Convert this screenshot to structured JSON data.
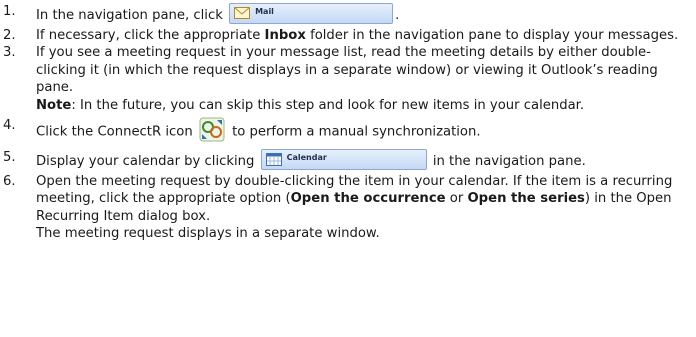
{
  "steps": [
    {
      "number": "1.",
      "before": "In the navigation pane, click",
      "button_label": "Mail",
      "after": "."
    },
    {
      "number": "2.",
      "before": "If necessary, click the appropriate",
      "bold": "Inbox",
      "after": "folder in the navigation pane to display your messages."
    },
    {
      "number": "3.",
      "text": "If you see a meeting request in your message list, read the meeting details by either double-clicking it (in which the request displays in a separate window) or viewing it Outlook’s reading pane.",
      "note_label": "Note",
      "note_text": ": In the future, you can skip this step and look for new items in your calendar."
    },
    {
      "number": "4.",
      "before": "Click the ConnectR icon",
      "after": "to perform a manual synchronization."
    },
    {
      "number": "5.",
      "before": "Display your calendar by clicking",
      "button_label": "Calendar",
      "after": "in the navigation pane."
    },
    {
      "number": "6.",
      "text": "Open the meeting request by double-clicking the item in your calendar. If the item is a recurring meeting, click the appropriate option (",
      "bold_1": "Open the occurrence",
      "mid": " or ",
      "bold_2": "Open the series",
      "after": ") in the Open Recurring Item dialog box.",
      "extra": "The meeting request displays in a separate window."
    }
  ],
  "icons": {
    "mail_button_icon": "envelope-icon",
    "connectr_icon": "connectr-sync-icon",
    "calendar_button_icon": "calendar-icon"
  }
}
